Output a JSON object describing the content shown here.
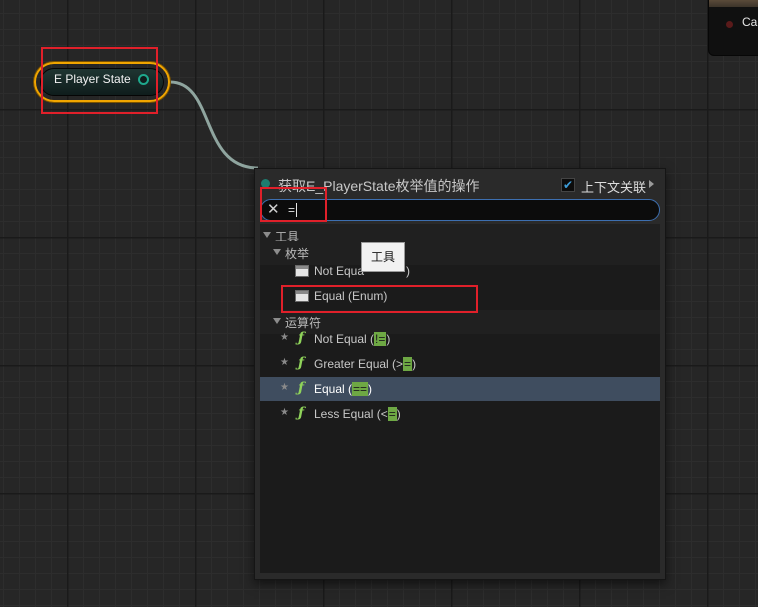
{
  "graph": {
    "variable_node": {
      "label": "E Player State"
    },
    "partial_node": {
      "label": "Ca"
    }
  },
  "menu": {
    "title": "获取E_PlayerState枚举值的操作",
    "context_sensitive": {
      "label": "上下文关联",
      "checked": true
    },
    "search": {
      "value": "="
    },
    "categories": {
      "tools": "工具",
      "enum": "枚举",
      "operators": "运算符"
    },
    "enum_items": [
      {
        "prefix": "Not Equa",
        "suffix": ")"
      },
      {
        "label": "Equal (Enum)"
      }
    ],
    "operator_items": [
      {
        "before": "Not Equal (",
        "match": "!=",
        "after": ")"
      },
      {
        "before": "Greater Equal (>",
        "match": "=",
        "after": ")"
      },
      {
        "before": "Equal (",
        "match": "==",
        "after": ")"
      },
      {
        "before": "Less Equal (<",
        "match": "=",
        "after": ")"
      }
    ],
    "selected_index": 2,
    "function_icon": "ƒ",
    "favorite_icon": "★"
  },
  "tooltip": {
    "text": "工具"
  },
  "colors": {
    "accent_blue": "#3d6fb0",
    "node_border": "#f0a500",
    "match_green": "#6ea844",
    "annotation_red": "#e0202a"
  }
}
